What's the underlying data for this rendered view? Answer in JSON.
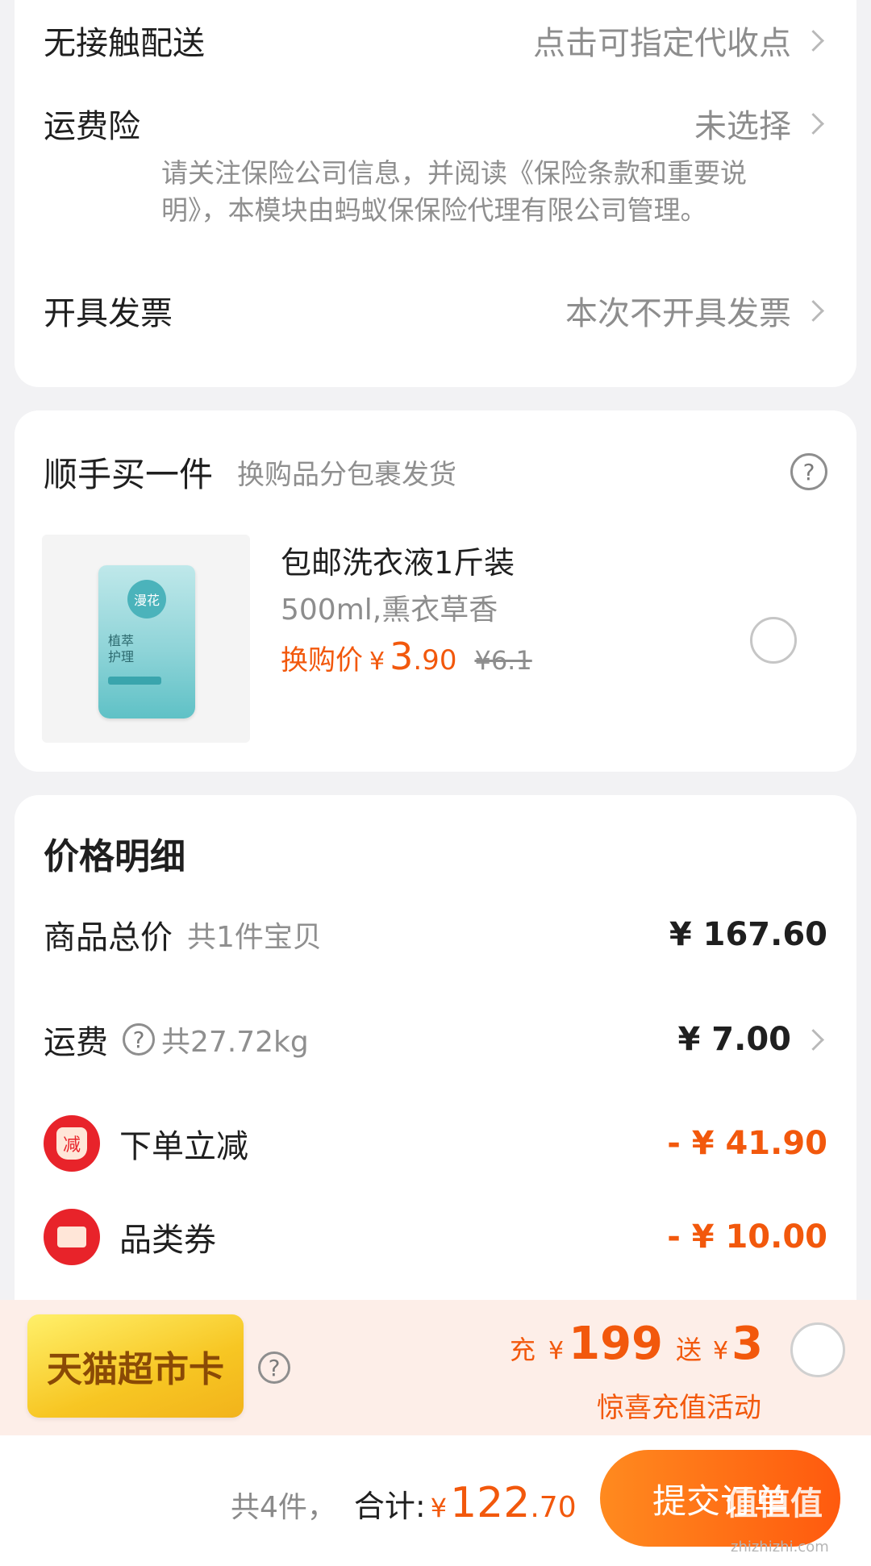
{
  "delivery": {
    "contactless_label": "无接触配送",
    "contactless_value": "点击可指定代收点",
    "insurance_label": "运费险",
    "insurance_value": "未选择",
    "insurance_note": "请关注保险公司信息，并阅读《保险条款和重要说明》，本模块由蚂蚁保保险代理有限公司管理。",
    "invoice_label": "开具发票",
    "invoice_value": "本次不开具发票"
  },
  "addon": {
    "title": "顺手买一件",
    "subtitle": "换购品分包裹发货",
    "product": {
      "brand_text": "漫花",
      "pack_line1": "植萃",
      "pack_line2": "护理",
      "name": "包邮洗衣液1斤装",
      "spec": "500ml,熏衣草香",
      "price_label": "换购价",
      "currency": "¥",
      "price_int": "3",
      "price_dec": ".90",
      "original_price": "¥6.1"
    }
  },
  "price_detail": {
    "title": "价格明细",
    "subtotal_label": "商品总价",
    "subtotal_note": "共1件宝贝",
    "subtotal_value": "¥ 167.60",
    "shipping_label": "运费",
    "shipping_note": "共27.72kg",
    "shipping_value": "¥ 7.00",
    "discount_icon_text": "减",
    "discount_label": "下单立减",
    "discount_value": "- ¥ 41.90",
    "coupon_label": "品类券",
    "coupon_value": "- ¥ 10.00"
  },
  "promo": {
    "card_text": "天猫超市卡",
    "charge_prefix": "充",
    "charge_currency": "¥",
    "charge_amount": "199",
    "gift_prefix": "送",
    "gift_currency": "¥",
    "gift_amount": "3",
    "caption": "惊喜充值活动"
  },
  "footer": {
    "count_text": "共4件，",
    "total_label": "合计:",
    "currency": "¥",
    "total_int": "122",
    "total_dec": ".70",
    "submit_label": "提交订单",
    "watermark": "值值值",
    "watermark_url": "zhizhizhi.com"
  },
  "colors": {
    "accent": "#f2580c",
    "page_bg": "#f2f2f4",
    "promo_bg": "#fdeee8"
  }
}
